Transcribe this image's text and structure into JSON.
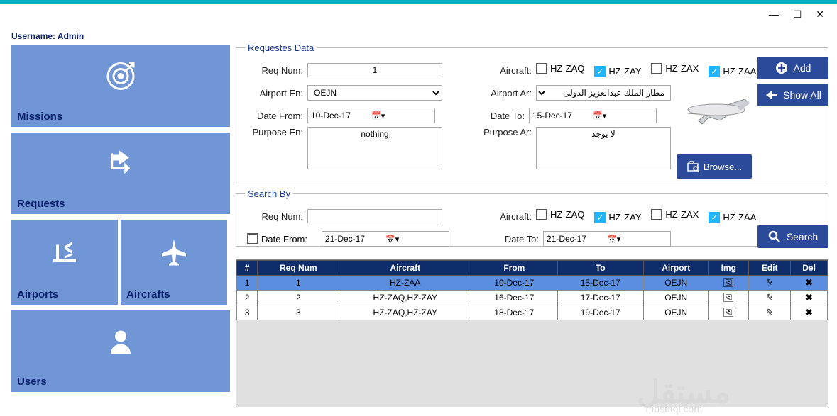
{
  "header": {
    "username_label": "Username: Admin"
  },
  "window": {
    "min": "—",
    "max": "☐",
    "close": "✕"
  },
  "tiles": {
    "missions": "Missions",
    "requests": "Requests",
    "airports": "Airports",
    "aircrafts": "Aircrafts",
    "users": "Users"
  },
  "requests_panel": {
    "legend": "Requestes Data",
    "req_num_lbl": "Req Num:",
    "req_num_val": "1",
    "aircraft_lbl": "Aircraft:",
    "aircrafts": [
      {
        "label": "HZ-ZAQ",
        "checked": false
      },
      {
        "label": "HZ-ZAY",
        "checked": true
      },
      {
        "label": "HZ-ZAX",
        "checked": false
      },
      {
        "label": "HZ-ZAA",
        "checked": true
      }
    ],
    "airport_en_lbl": "Airport En:",
    "airport_en_val": "OEJN",
    "airport_ar_lbl": "Airport Ar:",
    "airport_ar_val": "مطار الملك عبدالعزيز الدولى",
    "date_from_lbl": "Date From:",
    "date_from_val": "10-Dec-17",
    "date_to_lbl": "Date To:",
    "date_to_val": "15-Dec-17",
    "purpose_en_lbl": "Purpose En:",
    "purpose_en_val": "nothing",
    "purpose_ar_lbl": "Purpose Ar:",
    "purpose_ar_val": "لا يوجد",
    "add_btn": "Add",
    "showall_btn": "Show All",
    "browse_btn": "Browse..."
  },
  "search_panel": {
    "legend": "Search By",
    "req_num_lbl": "Req Num:",
    "req_num_val": "",
    "aircraft_lbl": "Aircraft:",
    "aircrafts": [
      {
        "label": "HZ-ZAQ",
        "checked": false
      },
      {
        "label": "HZ-ZAY",
        "checked": true
      },
      {
        "label": "HZ-ZAX",
        "checked": false
      },
      {
        "label": "HZ-ZAA",
        "checked": true
      }
    ],
    "date_from_chk": false,
    "date_from_lbl": "Date From:",
    "date_from_val": "21-Dec-17",
    "date_to_lbl": "Date To:",
    "date_to_val": "21-Dec-17",
    "search_btn": "Search"
  },
  "table": {
    "headers": [
      "#",
      "Req Num",
      "Aircraft",
      "From",
      "To",
      "Airport",
      "Img",
      "Edit",
      "Del"
    ],
    "rows": [
      {
        "n": "1",
        "req": "1",
        "ac": "HZ-ZAA",
        "from": "10-Dec-17",
        "to": "15-Dec-17",
        "ap": "OEJN",
        "sel": true
      },
      {
        "n": "2",
        "req": "2",
        "ac": "HZ-ZAQ,HZ-ZAY",
        "from": "16-Dec-17",
        "to": "17-Dec-17",
        "ap": "OEJN",
        "sel": false
      },
      {
        "n": "3",
        "req": "3",
        "ac": "HZ-ZAQ,HZ-ZAY",
        "from": "18-Dec-17",
        "to": "19-Dec-17",
        "ap": "OEJN",
        "sel": false
      }
    ]
  },
  "watermark": "مستقل",
  "watermark2": "mostaql.com"
}
